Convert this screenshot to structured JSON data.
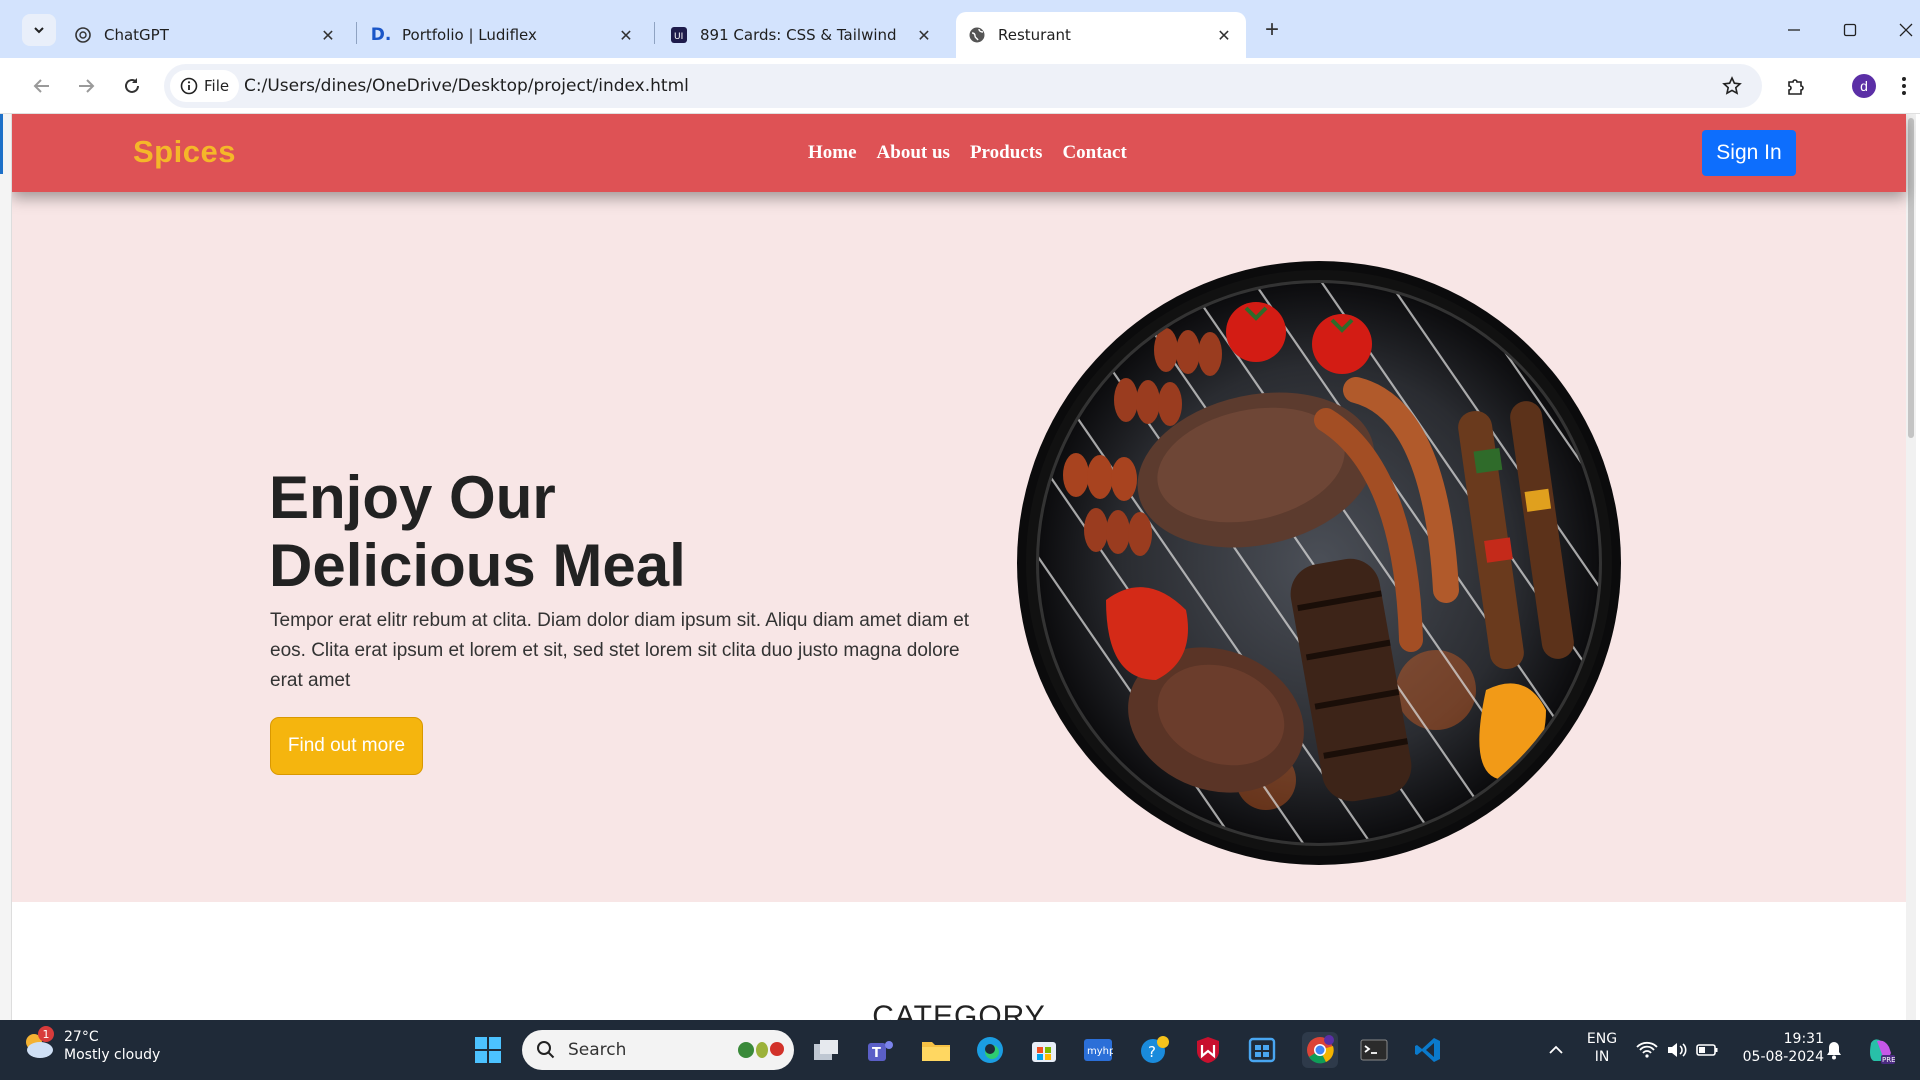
{
  "browser": {
    "tabs": [
      {
        "title": "ChatGPT",
        "active": false
      },
      {
        "title": "Portfolio | Ludiflex",
        "active": false
      },
      {
        "title": "891 Cards: CSS & Tailwind",
        "active": false
      },
      {
        "title": "Resturant",
        "active": true
      }
    ],
    "address_chip": "File",
    "url": "C:/Users/dines/OneDrive/Desktop/project/index.html",
    "profile_initial": "d"
  },
  "site": {
    "logo": "Spices",
    "nav": [
      "Home",
      "About us",
      "Products",
      "Contact"
    ],
    "signin_label": "Sign In",
    "hero": {
      "title_line1": "Enjoy Our",
      "title_line2": "Delicious Meal",
      "text": "Tempor erat elitr rebum at clita. Diam dolor diam ipsum sit. Aliqu diam amet diam et eos. Clita erat ipsum et lorem et sit, sed stet lorem sit clita duo justo magna dolore erat amet",
      "cta_label": "Find out more"
    },
    "section_title": "CATEGORY",
    "colors": {
      "header": "#de5255",
      "logo": "#f5b729",
      "signin": "#0d6efd",
      "hero_bg": "#f8e6e6",
      "cta": "#f5b50e"
    }
  },
  "taskbar": {
    "weather_badge": "1",
    "temperature": "27°C",
    "weather": "Mostly cloudy",
    "search_placeholder": "Search",
    "lang_line1": "ENG",
    "lang_line2": "IN",
    "time": "19:31",
    "date": "05-08-2024"
  }
}
